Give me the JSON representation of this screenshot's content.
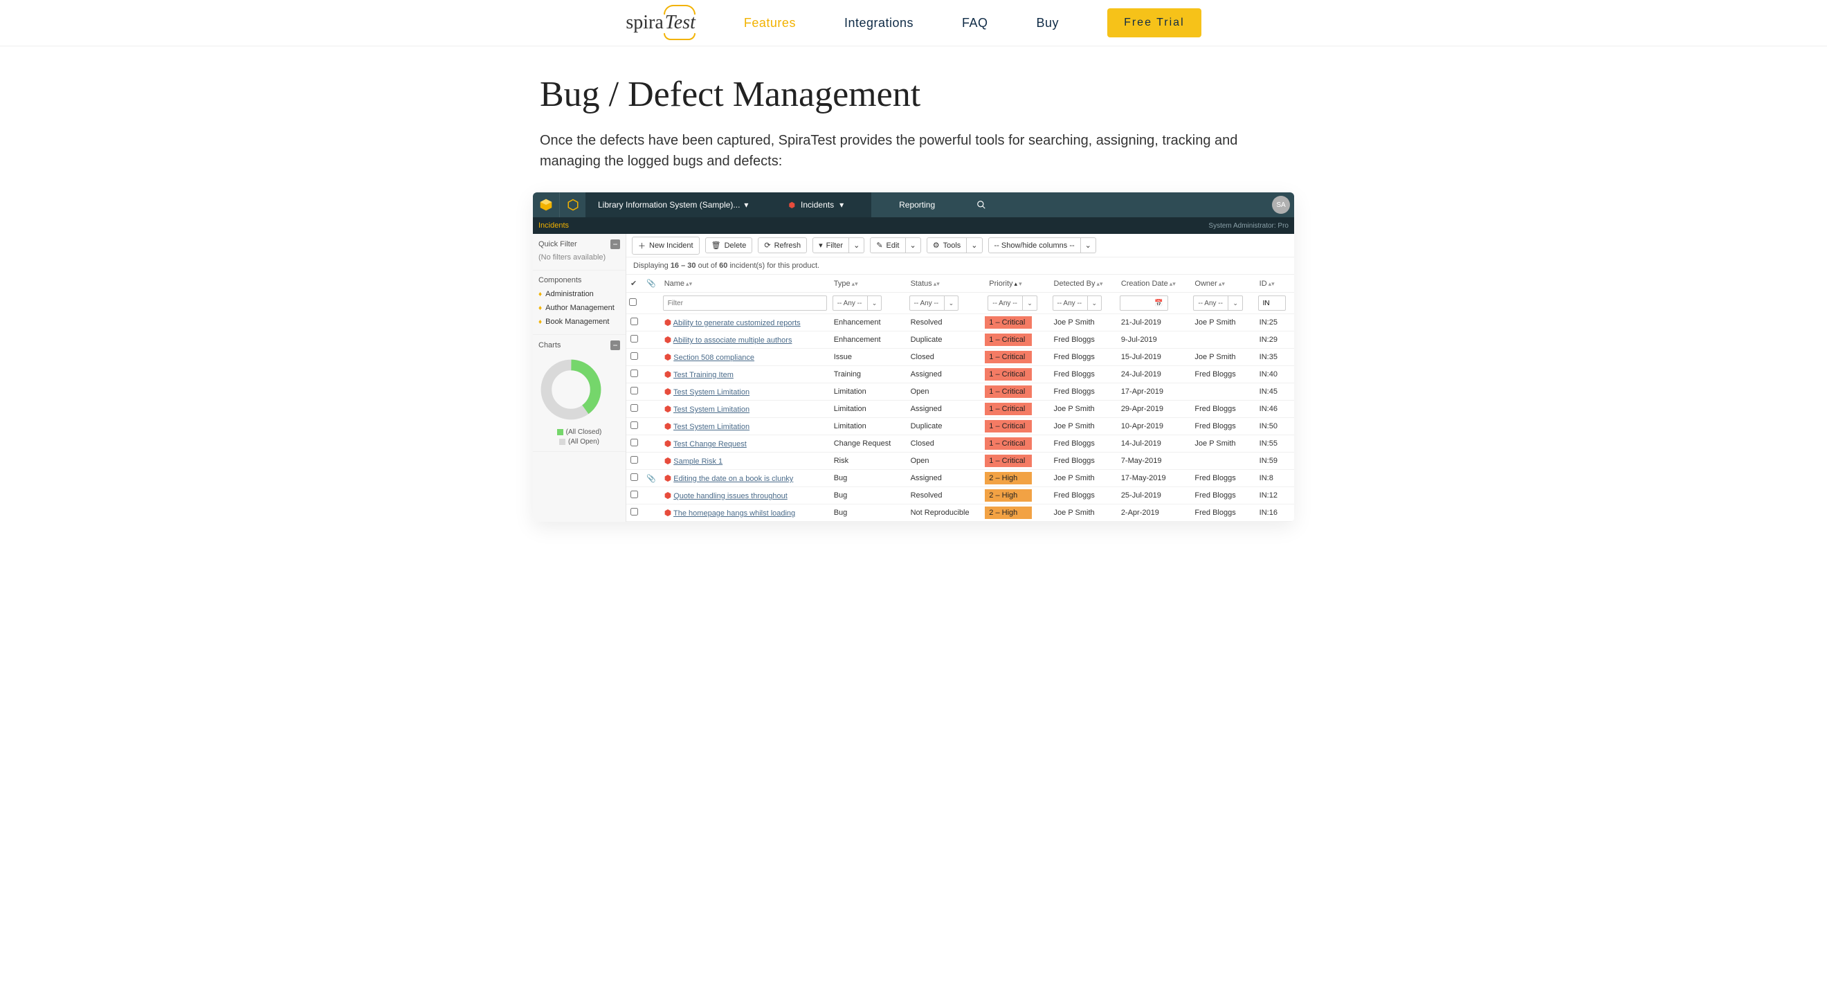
{
  "mkt": {
    "logo_a": "spira",
    "logo_b": "Test",
    "links": [
      "Features",
      "Integrations",
      "FAQ",
      "Buy"
    ],
    "cta": "Free Trial"
  },
  "hero": {
    "title": "Bug / Defect Management",
    "body": "Once the defects have been captured, SpiraTest provides the powerful tools for searching, assigning, tracking and managing the logged bugs and defects:"
  },
  "app": {
    "project": "Library Information System (Sample)...",
    "tab_incidents": "Incidents",
    "tab_reporting": "Reporting",
    "avatar": "SA",
    "sub_left": "Incidents",
    "sub_right": "System Administrator: Pro",
    "sidebar": {
      "sec_quick": "Quick Filter",
      "quick_note": "(No filters available)",
      "sec_components": "Components",
      "components": [
        "Administration",
        "Author Management",
        "Book Management"
      ],
      "sec_charts": "Charts",
      "legend_closed": "(All Closed)",
      "legend_open": "(All Open)"
    },
    "toolbar": {
      "new": "New Incident",
      "delete": "Delete",
      "refresh": "Refresh",
      "filter": "Filter",
      "edit": "Edit",
      "tools": "Tools",
      "cols": "-- Show/hide columns --"
    },
    "count": {
      "pre": "Displaying ",
      "range": "16 – 30",
      "mid": " out of ",
      "total": "60",
      "post": " incident(s) for this product."
    },
    "headers": {
      "name": "Name",
      "type": "Type",
      "status": "Status",
      "priority": "Priority",
      "detected": "Detected By",
      "created": "Creation Date",
      "owner": "Owner",
      "id": "ID"
    },
    "filters": {
      "name_ph": "Filter",
      "any": "-- Any --",
      "id_prefix": "IN"
    },
    "colors": {
      "c1": "#f47b64",
      "c2": "#f2a244",
      "accent": "#f2b200",
      "topbar": "#2f4c55"
    },
    "rows": [
      {
        "att": false,
        "name": "Ability to generate customized reports",
        "type": "Enhancement",
        "status": "Resolved",
        "pri": "1 – Critical",
        "pc": "c1",
        "det": "Joe P Smith",
        "date": "21-Jul-2019",
        "own": "Joe P Smith",
        "id": "IN:25"
      },
      {
        "att": false,
        "name": "Ability to associate multiple authors",
        "type": "Enhancement",
        "status": "Duplicate",
        "pri": "1 – Critical",
        "pc": "c1",
        "det": "Fred Bloggs",
        "date": "9-Jul-2019",
        "own": "",
        "id": "IN:29"
      },
      {
        "att": false,
        "name": "Section 508 compliance",
        "type": "Issue",
        "status": "Closed",
        "pri": "1 – Critical",
        "pc": "c1",
        "det": "Fred Bloggs",
        "date": "15-Jul-2019",
        "own": "Joe P Smith",
        "id": "IN:35"
      },
      {
        "att": false,
        "name": "Test Training Item",
        "type": "Training",
        "status": "Assigned",
        "pri": "1 – Critical",
        "pc": "c1",
        "det": "Fred Bloggs",
        "date": "24-Jul-2019",
        "own": "Fred Bloggs",
        "id": "IN:40"
      },
      {
        "att": false,
        "name": "Test System Limitation",
        "type": "Limitation",
        "status": "Open",
        "pri": "1 – Critical",
        "pc": "c1",
        "det": "Fred Bloggs",
        "date": "17-Apr-2019",
        "own": "",
        "id": "IN:45"
      },
      {
        "att": false,
        "name": "Test System Limitation",
        "type": "Limitation",
        "status": "Assigned",
        "pri": "1 – Critical",
        "pc": "c1",
        "det": "Joe P Smith",
        "date": "29-Apr-2019",
        "own": "Fred Bloggs",
        "id": "IN:46"
      },
      {
        "att": false,
        "name": "Test System Limitation",
        "type": "Limitation",
        "status": "Duplicate",
        "pri": "1 – Critical",
        "pc": "c1",
        "det": "Joe P Smith",
        "date": "10-Apr-2019",
        "own": "Fred Bloggs",
        "id": "IN:50"
      },
      {
        "att": false,
        "name": "Test Change Request",
        "type": "Change Request",
        "status": "Closed",
        "pri": "1 – Critical",
        "pc": "c1",
        "det": "Fred Bloggs",
        "date": "14-Jul-2019",
        "own": "Joe P Smith",
        "id": "IN:55"
      },
      {
        "att": false,
        "name": "Sample Risk 1",
        "type": "Risk",
        "status": "Open",
        "pri": "1 – Critical",
        "pc": "c1",
        "det": "Fred Bloggs",
        "date": "7-May-2019",
        "own": "",
        "id": "IN:59"
      },
      {
        "att": true,
        "name": "Editing the date on a book is clunky",
        "type": "Bug",
        "status": "Assigned",
        "pri": "2 – High",
        "pc": "c2",
        "det": "Joe P Smith",
        "date": "17-May-2019",
        "own": "Fred Bloggs",
        "id": "IN:8"
      },
      {
        "att": false,
        "name": "Quote handling issues throughout",
        "type": "Bug",
        "status": "Resolved",
        "pri": "2 – High",
        "pc": "c2",
        "det": "Fred Bloggs",
        "date": "25-Jul-2019",
        "own": "Fred Bloggs",
        "id": "IN:12"
      },
      {
        "att": false,
        "name": "The homepage hangs whilst loading",
        "type": "Bug",
        "status": "Not Reproducible",
        "pri": "2 – High",
        "pc": "c2",
        "det": "Joe P Smith",
        "date": "2-Apr-2019",
        "own": "Fred Bloggs",
        "id": "IN:16"
      }
    ]
  },
  "chart_data": {
    "type": "pie",
    "title": "",
    "series": [
      {
        "name": "(All Closed)",
        "value": 40,
        "color": "#75d66b"
      },
      {
        "name": "(All Open)",
        "value": 60,
        "color": "#d9d9d9"
      }
    ]
  }
}
